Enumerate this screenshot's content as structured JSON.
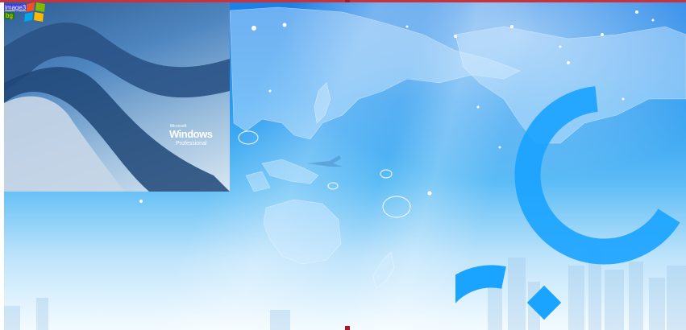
{
  "labels": {
    "image_link": "image3",
    "status_badge": "bg"
  },
  "xp_wallpaper": {
    "brand": "Windows",
    "edition": "Professional",
    "maker": "Microsoft"
  },
  "colors": {
    "accent_border": "#c8323c",
    "sky_top": "#1c7fe6",
    "sky_bottom": "#f4fbff",
    "logo_blue": "#1aa3ff"
  }
}
